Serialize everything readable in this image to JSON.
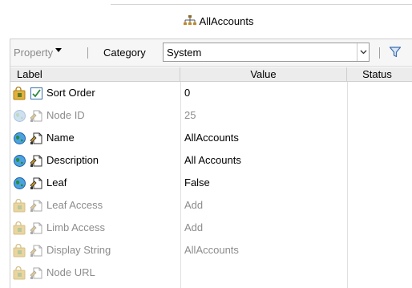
{
  "header": {
    "title": "AllAccounts",
    "title_icon": "hierarchy-icon"
  },
  "toolbar": {
    "property_label": "Property",
    "category_label": "Category",
    "category_value": "System",
    "filter_icon": "filter-icon"
  },
  "grid": {
    "columns": {
      "label": "Label",
      "value": "Value",
      "status": "Status"
    },
    "rows": [
      {
        "label": "Sort Order",
        "value": "0",
        "enabled": true,
        "icon1": "lock-folder-icon",
        "icon2": "checkbox-checked-icon"
      },
      {
        "label": "Node ID",
        "value": "25",
        "enabled": false,
        "icon1": "globe-icon",
        "icon2": "document-icon"
      },
      {
        "label": "Name",
        "value": "AllAccounts",
        "enabled": true,
        "icon1": "globe-icon",
        "icon2": "document-icon"
      },
      {
        "label": "Description",
        "value": "All Accounts",
        "enabled": true,
        "icon1": "globe-icon",
        "icon2": "document-icon"
      },
      {
        "label": "Leaf",
        "value": "False",
        "enabled": true,
        "icon1": "globe-icon",
        "icon2": "document-icon"
      },
      {
        "label": "Leaf Access",
        "value": "Add",
        "enabled": false,
        "icon1": "lock-folder-icon",
        "icon2": "document-icon"
      },
      {
        "label": "Limb Access",
        "value": "Add",
        "enabled": false,
        "icon1": "lock-folder-icon",
        "icon2": "document-icon"
      },
      {
        "label": "Display String",
        "value": "AllAccounts",
        "enabled": false,
        "icon1": "lock-folder-icon",
        "icon2": "document-icon"
      },
      {
        "label": "Node URL",
        "value": "",
        "enabled": false,
        "icon1": "lock-folder-icon",
        "icon2": "document-icon"
      }
    ]
  },
  "colors": {
    "disabled_text": "#8c8c8c",
    "header_bg": "#ececec",
    "toolbar_bg": "#f6f6f6",
    "filter_accent": "#3a6fb0"
  }
}
